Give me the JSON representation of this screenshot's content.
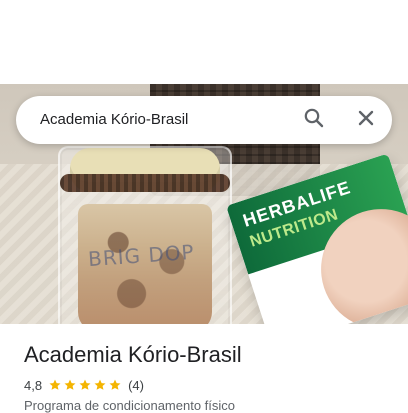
{
  "search": {
    "query": "Academia Kório-Brasil",
    "icons": {
      "search": "search-icon",
      "close": "close-icon"
    }
  },
  "photo": {
    "cup_text": "BRIG DOP",
    "magazine": {
      "title": "HERBALIFE",
      "subtitle": "NUTRITION"
    }
  },
  "place": {
    "title": "Academia Kório-Brasil",
    "rating": "4,8",
    "stars": 5,
    "review_count": "(4)",
    "category": "Programa de condicionamento físico"
  },
  "colors": {
    "star": "#f4b400",
    "text_primary": "#202124",
    "text_secondary": "#5f6368",
    "icon": "#5f6368"
  }
}
